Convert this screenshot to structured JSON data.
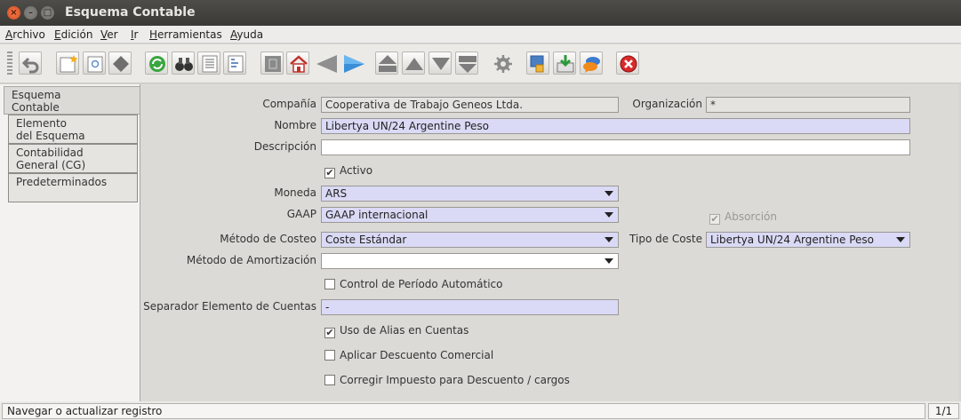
{
  "window": {
    "title": "Esquema Contable"
  },
  "menu": [
    {
      "label": "Archivo",
      "accel": "A",
      "rest": "rchivo"
    },
    {
      "label": "Edición",
      "accel": "E",
      "rest": "dición"
    },
    {
      "label": "Ver",
      "accel": "V",
      "rest": "er"
    },
    {
      "label": "Ir",
      "accel": "I",
      "rest": "r"
    },
    {
      "label": "Herramientas",
      "accel": "H",
      "rest": "erramientas"
    },
    {
      "label": "Ayuda",
      "accel": "A",
      "rest": "yuda"
    }
  ],
  "tabs": [
    {
      "line1": "Esquema",
      "line2": "Contable"
    },
    {
      "line1": "Elemento",
      "line2": "del Esquema Contable"
    },
    {
      "line1": "Contabilidad",
      "line2": "General (CG)"
    },
    {
      "line1": "Predeterminados",
      "line2": ""
    }
  ],
  "form": {
    "compania_label": "Compañía",
    "compania_value": "Cooperativa de Trabajo Geneos Ltda.",
    "organizacion_label": "Organización",
    "organizacion_value": "*",
    "nombre_label": "Nombre",
    "nombre_value": "Libertya UN/24 Argentine Peso",
    "descripcion_label": "Descripción",
    "descripcion_value": "",
    "activo_label": "Activo",
    "moneda_label": "Moneda",
    "moneda_value": "ARS",
    "gaap_label": "GAAP",
    "gaap_value": "GAAP internacional",
    "absorcion_label": "Absorción",
    "metodo_costeo_label": "Método de Costeo",
    "metodo_costeo_value": "Coste Estándar",
    "tipo_coste_label": "Tipo de Coste",
    "tipo_coste_value": "Libertya UN/24 Argentine Peso",
    "metodo_amortizacion_label": "Método de Amortización",
    "metodo_amortizacion_value": "",
    "control_periodo_label": "Control de Período Automático",
    "separador_label": "Separador Elemento de Cuentas",
    "separador_value": "-",
    "uso_alias_label": "Uso de Alias en Cuentas",
    "aplicar_descuento_label": "Aplicar Descuento Comercial",
    "corregir_impuesto_label": "Corregir Impuesto para Descuento / cargos"
  },
  "checks": {
    "activo": true,
    "absorcion": true,
    "control_periodo": false,
    "uso_alias": true,
    "aplicar_descuento": false,
    "corregir_impuesto": false
  },
  "status": {
    "message": "Navegar o actualizar registro",
    "record": "1/1"
  },
  "icons": [
    "undo-icon",
    "new-record-icon",
    "copy-record-icon",
    "delete-record-icon",
    "refresh-icon",
    "find-icon",
    "history-icon",
    "grid-toggle-icon",
    "attachment-icon",
    "home-icon",
    "previous-record-icon",
    "next-record-icon",
    "first-record-icon",
    "previous-page-icon",
    "next-page-icon",
    "last-record-icon",
    "workflow-icon",
    "print-preview-icon",
    "export-icon",
    "chat-icon",
    "exit-icon"
  ]
}
